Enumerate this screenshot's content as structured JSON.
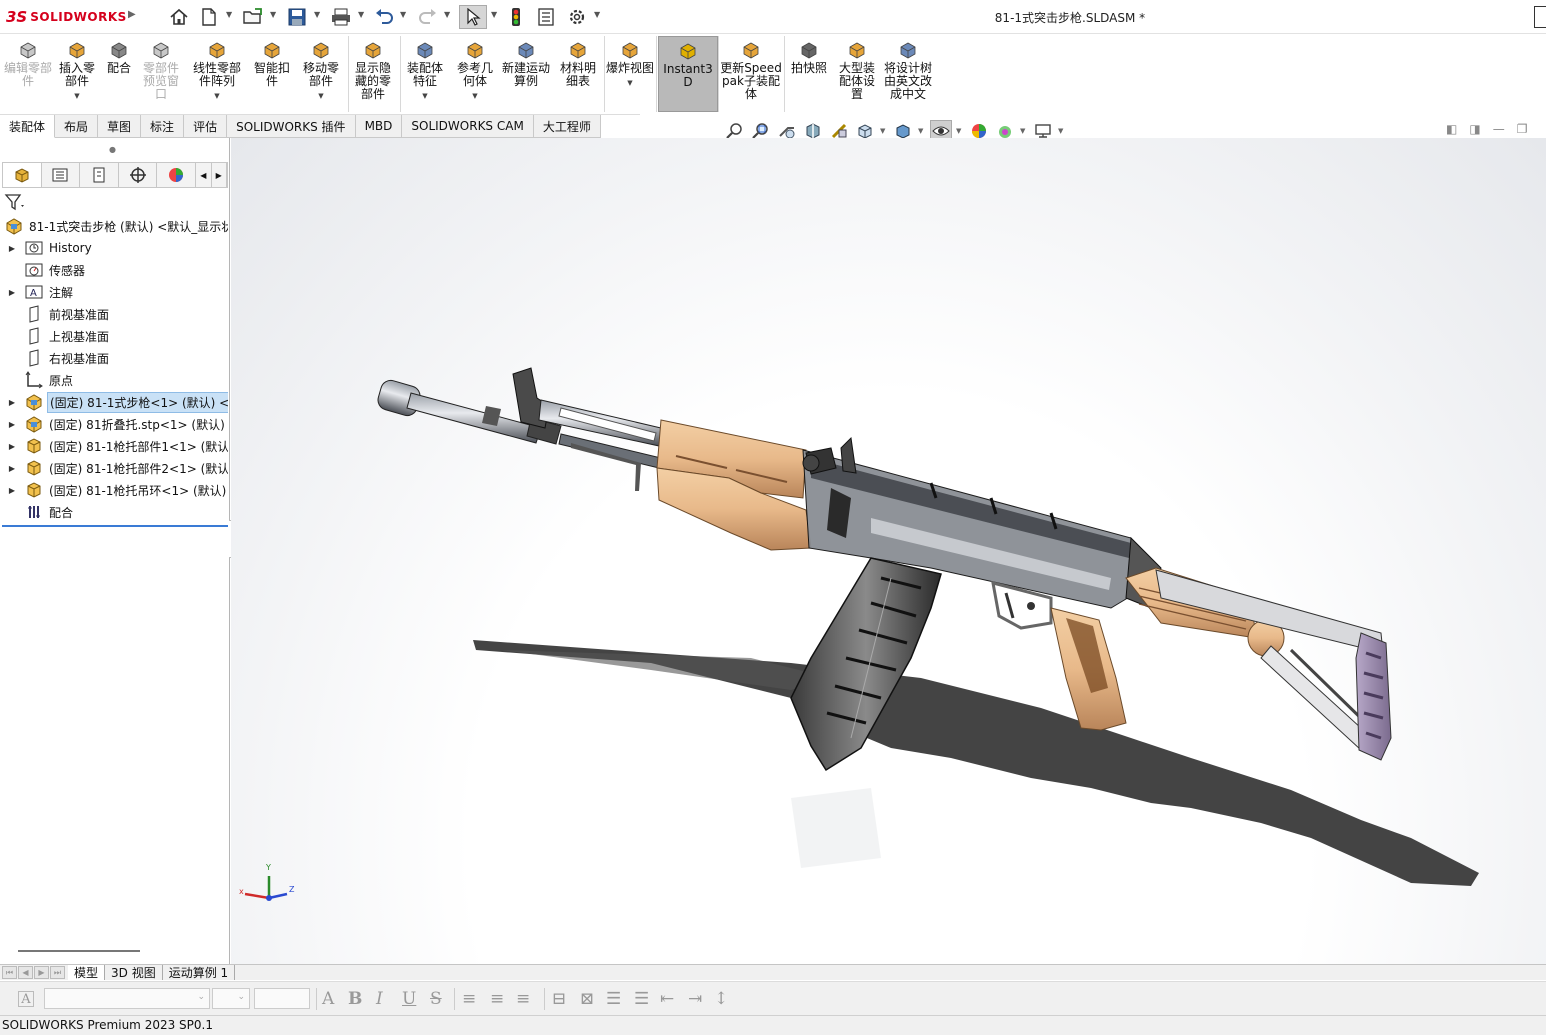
{
  "app": {
    "logo_prefix": "3S",
    "logo_text": "SOLIDWORKS",
    "document_title": "81-1式突击步枪.SLDASM *"
  },
  "ribbon": {
    "buttons": [
      {
        "label": "编辑零部件",
        "icon": "edit-component-icon",
        "enabled": false
      },
      {
        "label": "插入零部件",
        "icon": "insert-component-icon",
        "enabled": true
      },
      {
        "label": "配合",
        "icon": "mate-icon",
        "enabled": true
      },
      {
        "label": "零部件预览窗口",
        "icon": "component-preview-icon",
        "enabled": false
      },
      {
        "label": "线性零部件阵列",
        "icon": "linear-pattern-icon",
        "enabled": true
      },
      {
        "label": "智能扣件",
        "icon": "smart-fasteners-icon",
        "enabled": true
      },
      {
        "label": "移动零部件",
        "icon": "move-component-icon",
        "enabled": true
      },
      {
        "label": "显示隐藏的零部件",
        "icon": "show-hidden-icon",
        "enabled": true
      },
      {
        "label": "装配体特征",
        "icon": "assembly-feature-icon",
        "enabled": true
      },
      {
        "label": "参考几何体",
        "icon": "reference-geometry-icon",
        "enabled": true
      },
      {
        "label": "新建运动算例",
        "icon": "motion-study-icon",
        "enabled": true
      },
      {
        "label": "材料明细表",
        "icon": "bom-icon",
        "enabled": true
      },
      {
        "label": "爆炸视图",
        "icon": "exploded-view-icon",
        "enabled": true
      },
      {
        "label": "Instant3D",
        "icon": "instant3d-icon",
        "enabled": true
      },
      {
        "label": "更新Speedpak子装配体",
        "icon": "speedpak-icon",
        "enabled": true
      },
      {
        "label": "拍快照",
        "icon": "snapshot-icon",
        "enabled": true
      },
      {
        "label": "大型装配体设置",
        "icon": "large-assembly-icon",
        "enabled": true
      },
      {
        "label": "将设计树由英文改成中文",
        "icon": "translate-tree-icon",
        "enabled": true
      }
    ]
  },
  "command_tabs": [
    "装配体",
    "布局",
    "草图",
    "标注",
    "评估",
    "SOLIDWORKS 插件",
    "MBD",
    "SOLIDWORKS CAM",
    "大工程师"
  ],
  "tree": {
    "root": "81-1式突击步枪 (默认) <默认_显示状",
    "items": [
      {
        "label": "History",
        "icon": "history-folder-icon",
        "expandable": true
      },
      {
        "label": "传感器",
        "icon": "sensor-folder-icon",
        "expandable": false
      },
      {
        "label": "注解",
        "icon": "annotation-folder-icon",
        "expandable": true
      },
      {
        "label": "前视基准面",
        "icon": "plane-icon",
        "expandable": false
      },
      {
        "label": "上视基准面",
        "icon": "plane-icon",
        "expandable": false
      },
      {
        "label": "右视基准面",
        "icon": "plane-icon",
        "expandable": false
      },
      {
        "label": "原点",
        "icon": "origin-icon",
        "expandable": false
      },
      {
        "label": "(固定) 81-1式步枪<1> (默认) <默",
        "icon": "subassembly-icon",
        "expandable": true,
        "selected": true
      },
      {
        "label": "(固定) 81折叠托.stp<1> (默认) <",
        "icon": "subassembly-icon",
        "expandable": true
      },
      {
        "label": "(固定) 81-1枪托部件1<1> (默认)",
        "icon": "part-icon",
        "expandable": true
      },
      {
        "label": "(固定) 81-1枪托部件2<1> (默认)",
        "icon": "part-icon",
        "expandable": true
      },
      {
        "label": "(固定) 81-1枪托吊环<1> (默认)",
        "icon": "part-icon",
        "expandable": true
      },
      {
        "label": "配合",
        "icon": "mates-folder-icon",
        "expandable": false
      }
    ]
  },
  "triad": {
    "x": "x",
    "y": "Y",
    "z": "Z"
  },
  "bottom_tabs": [
    "模型",
    "3D 视图",
    "运动算例 1"
  ],
  "format_bar": {
    "bold": "B",
    "italic": "I",
    "underline": "U",
    "strike": "S",
    "font_icon": "A"
  },
  "status": {
    "text": "SOLIDWORKS Premium 2023 SP0.1"
  },
  "colors": {
    "accent": "#d5001c",
    "wood": "#e8b98a",
    "selection": "#c9e1f6"
  }
}
